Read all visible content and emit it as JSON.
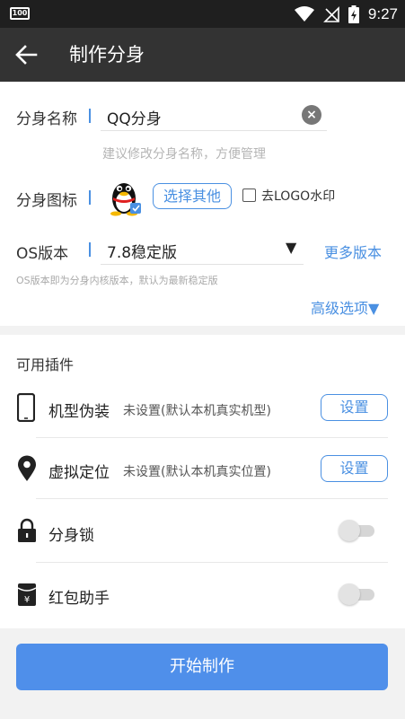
{
  "status_bar": {
    "battery_left": "100",
    "time": "9:27"
  },
  "app_bar": {
    "title": "制作分身",
    "back_icon": "arrow-left-icon"
  },
  "form": {
    "name_label": "分身名称",
    "name_value": "QQ分身",
    "name_hint": "建议修改分身名称，方便管理",
    "icon_label": "分身图标",
    "choose_other": "选择其他",
    "remove_logo_label": "去LOGO水印",
    "remove_logo_checked": false,
    "os_label": "OS版本",
    "os_value": "7.8稳定版",
    "more_versions": "更多版本",
    "os_hint": "OS版本即为分身内核版本，默认为最新稳定版",
    "advanced": "高级选项▼"
  },
  "plugins": {
    "title": "可用插件",
    "items": [
      {
        "name": "机型伪装",
        "desc": "未设置(默认本机真实机型)",
        "action": "设置",
        "icon": "phone-icon"
      },
      {
        "name": "虚拟定位",
        "desc": "未设置(默认本机真实位置)",
        "action": "设置",
        "icon": "location-pin-icon"
      },
      {
        "name": "分身锁",
        "toggle": false,
        "icon": "lock-icon"
      },
      {
        "name": "红包助手",
        "toggle": false,
        "icon": "red-envelope-icon"
      }
    ]
  },
  "start_button": "开始制作",
  "colors": {
    "accent": "#4a90e2",
    "primary_button": "#4f8fea",
    "app_bar": "#333333",
    "status_bar": "#1f1f1f"
  }
}
